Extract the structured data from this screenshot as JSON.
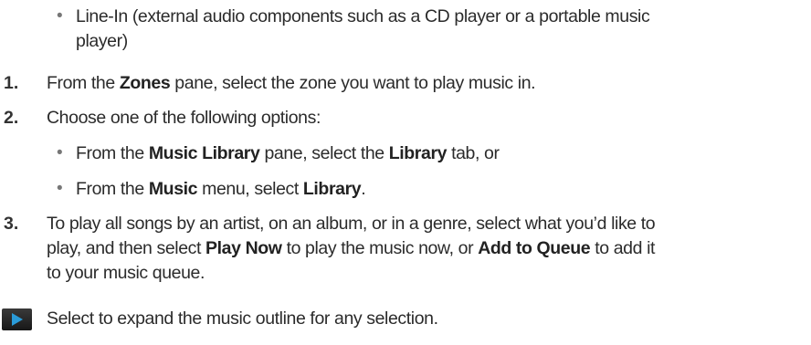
{
  "intro_bullet": {
    "line1": "Line-In (external audio components such as a CD player or a portable music",
    "line2": "player)"
  },
  "steps": [
    {
      "number": "1.",
      "pre": "From the ",
      "bold": "Zones",
      "post": " pane, select the zone you want to play music in."
    },
    {
      "number": "2.",
      "text": "Choose one of the following options:"
    },
    {
      "number": "3.",
      "line1": "To play all songs by an artist, on an album, or in a genre, select what you’d like to",
      "line2_pre": "play, and then select ",
      "line2_bold1": "Play Now",
      "line2_mid": " to play the music now, or ",
      "line2_bold2": "Add to Queue",
      "line2_post": " to add it",
      "line3": "to your music queue."
    }
  ],
  "sub_options": [
    {
      "pre": "From the ",
      "bold1": "Music Library",
      "mid": " pane, select the ",
      "bold2": "Library",
      "post": " tab, or"
    },
    {
      "pre": "From the ",
      "bold1": "Music",
      "mid": " menu, select ",
      "bold2": "Library",
      "post": "."
    }
  ],
  "bullet_glyph": "•",
  "footer_note": "Select  to expand the music outline for any selection.",
  "icons": {
    "expand": "play-triangle-icon"
  },
  "colors": {
    "text": "#2b2b2b",
    "bullet": "#777777",
    "icon_bg": "#1f1f1f",
    "icon_glyph": "#2a9bd8"
  }
}
